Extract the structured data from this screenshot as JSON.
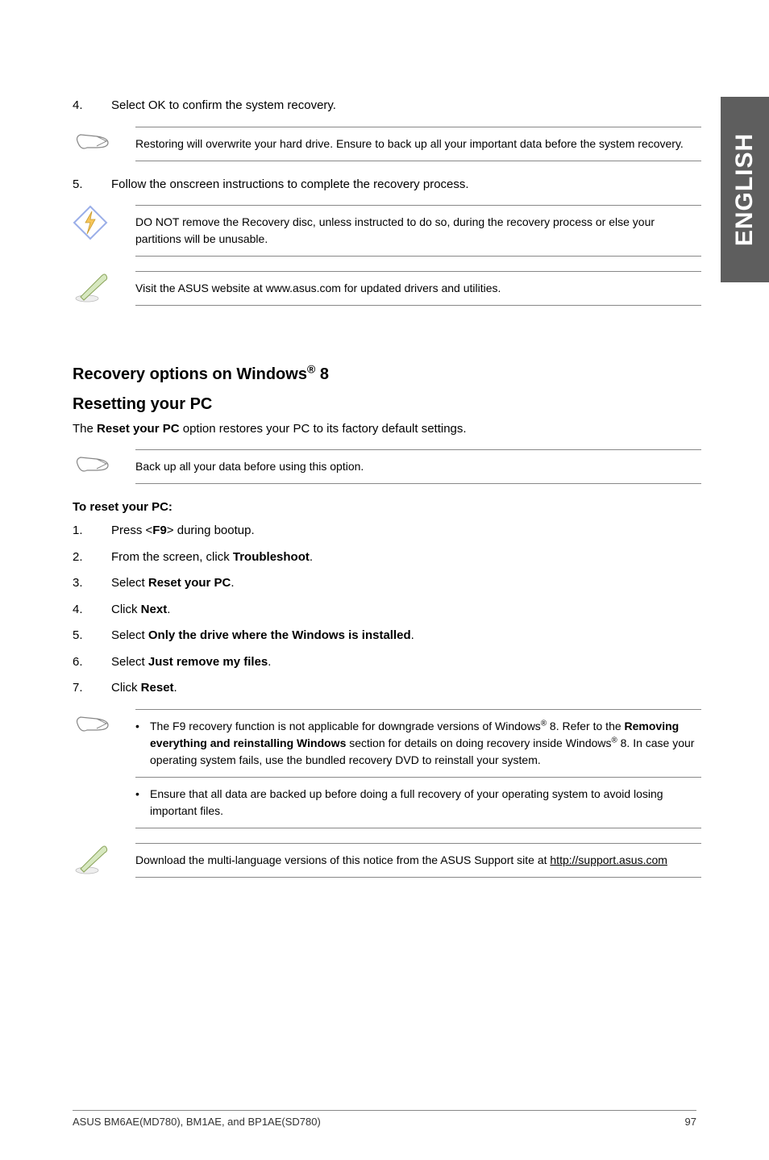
{
  "sidebar": {
    "label": "ENGLISH"
  },
  "step4": {
    "num": "4.",
    "text_before": "Select OK to confirm the system recovery."
  },
  "note1": "Restoring will overwrite your hard drive. Ensure to back up all your important data before the system recovery.",
  "step5": {
    "num": "5.",
    "text": "Follow the onscreen instructions to complete the recovery process."
  },
  "note2": "DO NOT remove the Recovery disc, unless instructed to do so, during the recovery process or else your partitions will be unusable.",
  "note3": "Visit the ASUS website at www.asus.com for updated drivers and utilities.",
  "section_title": "Recovery options on Windows® 8",
  "subsection_title": "Resetting your PC",
  "reset_intro_before": "The ",
  "reset_intro_bold": "Reset your PC",
  "reset_intro_after": " option restores your PC to its factory default settings.",
  "note4": "Back up all your data before using this option.",
  "subhead": "To reset your PC:",
  "steps": [
    {
      "num": "1.",
      "pre": "Press <",
      "b": "F9",
      "post": "> during bootup."
    },
    {
      "num": "2.",
      "pre": "From the screen, click ",
      "b": "Troubleshoot",
      "post": "."
    },
    {
      "num": "3.",
      "pre": "Select ",
      "b": "Reset your PC",
      "post": "."
    },
    {
      "num": "4.",
      "pre": "Click ",
      "b": "Next",
      "post": "."
    },
    {
      "num": "5.",
      "pre": "Select ",
      "b": "Only the drive where the Windows is installed",
      "post": "."
    },
    {
      "num": "6.",
      "pre": "Select ",
      "b": "Just remove my files",
      "post": "."
    },
    {
      "num": "7.",
      "pre": "Click ",
      "b": "Reset",
      "post": "."
    }
  ],
  "note5_a_pre": "The F9 recovery function is not applicable for downgrade versions of Windows® 8. Refer to the ",
  "note5_a_b": "Removing everything and reinstalling Windows",
  "note5_a_post": " section for details on doing recovery inside Windows® 8. In case your operating system fails, use the bundled recovery DVD to reinstall your system.",
  "note5_b": "Ensure that all data are backed up before doing a full recovery of your operating system to avoid losing important files.",
  "note6_pre": "Download the multi-language versions of this notice from the ASUS Support site at ",
  "note6_link": "http://support.asus.com",
  "footer": {
    "left": "ASUS BM6AE(MD780), BM1AE, and BP1AE(SD780)",
    "right": "97"
  }
}
